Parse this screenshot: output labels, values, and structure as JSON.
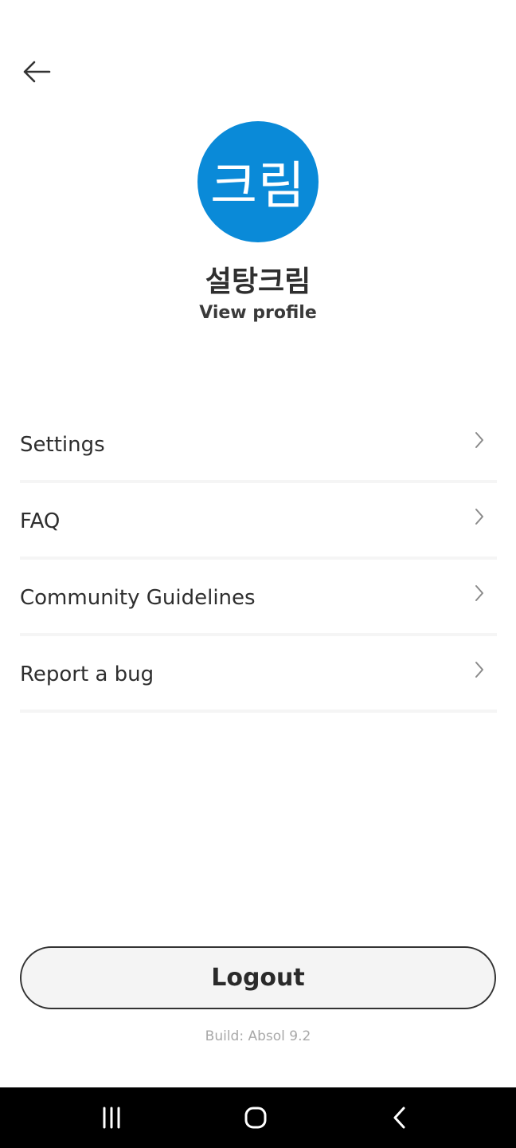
{
  "header": {
    "back_icon": "arrow-left-icon"
  },
  "profile": {
    "avatar_text": "크림",
    "avatar_color": "#0a8ad8",
    "display_name": "설탕크림",
    "view_profile_label": "View profile"
  },
  "menu": {
    "items": [
      {
        "label": "Settings",
        "icon": "chevron-right-icon"
      },
      {
        "label": "FAQ",
        "icon": "chevron-right-icon"
      },
      {
        "label": "Community Guidelines",
        "icon": "chevron-right-icon"
      },
      {
        "label": "Report a bug",
        "icon": "chevron-right-icon"
      }
    ]
  },
  "footer": {
    "logout_label": "Logout",
    "build_text": "Build: Absol 9.2"
  },
  "system_nav": {
    "recents_icon": "recents-icon",
    "home_icon": "home-icon",
    "back_icon": "back-chevron-icon"
  }
}
